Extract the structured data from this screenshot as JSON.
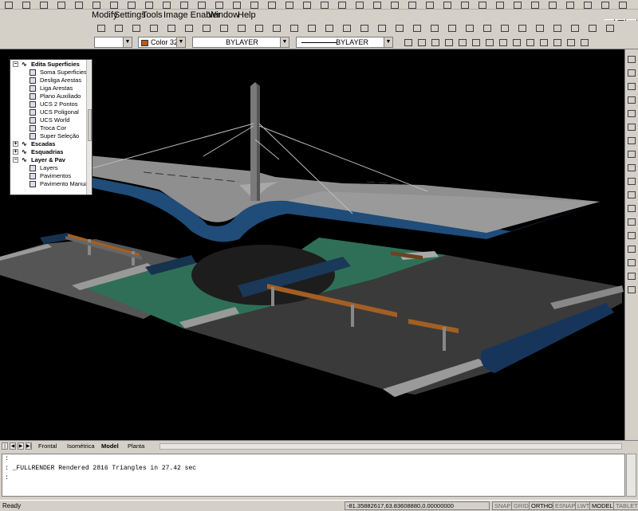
{
  "menubar": {
    "items": [
      "Modify",
      "Settings",
      "Tools",
      "Image Enabler",
      "Window",
      "Help"
    ]
  },
  "toolbar": {
    "color_combo": "Color 32",
    "linetype_combo": "BYLAYER",
    "lineweight_combo": "BYLAYER"
  },
  "tree": {
    "items": [
      {
        "label": "Edita Superficies",
        "level": 0,
        "header": true,
        "expander": "−"
      },
      {
        "label": "Soma Superficies",
        "level": 1
      },
      {
        "label": "Desliga Arestas",
        "level": 1
      },
      {
        "label": "Liga Arestas",
        "level": 1
      },
      {
        "label": "Plano Auxiliado",
        "level": 1
      },
      {
        "label": "UCS 2 Pontos",
        "level": 1
      },
      {
        "label": "UCS Poligonal",
        "level": 1
      },
      {
        "label": "UCS World",
        "level": 1
      },
      {
        "label": "Troca Cor",
        "level": 1
      },
      {
        "label": "Super Seleção",
        "level": 1
      },
      {
        "label": "Escadas",
        "level": 0,
        "header": true,
        "expander": "+"
      },
      {
        "label": "Esquadrias",
        "level": 0,
        "header": true,
        "expander": "+"
      },
      {
        "label": "Layer & Pav",
        "level": 0,
        "header": true,
        "expander": "−"
      },
      {
        "label": "Layers",
        "level": 1
      },
      {
        "label": "Pavimentos",
        "level": 1
      },
      {
        "label": "Pavimento Manual",
        "level": 1
      }
    ]
  },
  "tabs": {
    "items": [
      "Frontal",
      "Isométrica",
      "Model",
      "Planta"
    ],
    "active": "Model"
  },
  "command": {
    "lines": [
      ":",
      ": _FULLRENDER Rendered 2816 Triangles in 27.42 sec",
      ":"
    ]
  },
  "status": {
    "ready": "Ready",
    "coords": "-81.35882617,63.83608880,0.00000000",
    "toggles": [
      {
        "label": "SNAP",
        "on": false
      },
      {
        "label": "GRID",
        "on": false
      },
      {
        "label": "ORTHO",
        "on": true
      },
      {
        "label": "ESNAP",
        "on": false
      },
      {
        "label": "LWT",
        "on": false
      },
      {
        "label": "MODEL",
        "on": true
      },
      {
        "label": "TABLET",
        "on": false
      }
    ]
  },
  "colors": {
    "roof_top": "#8f8f8f",
    "roof_edge": "#1f4c78",
    "grass": "#2f6f57",
    "road": "#3c3c3c",
    "curb": "#9a9a9a",
    "bench": "#a35f23"
  }
}
